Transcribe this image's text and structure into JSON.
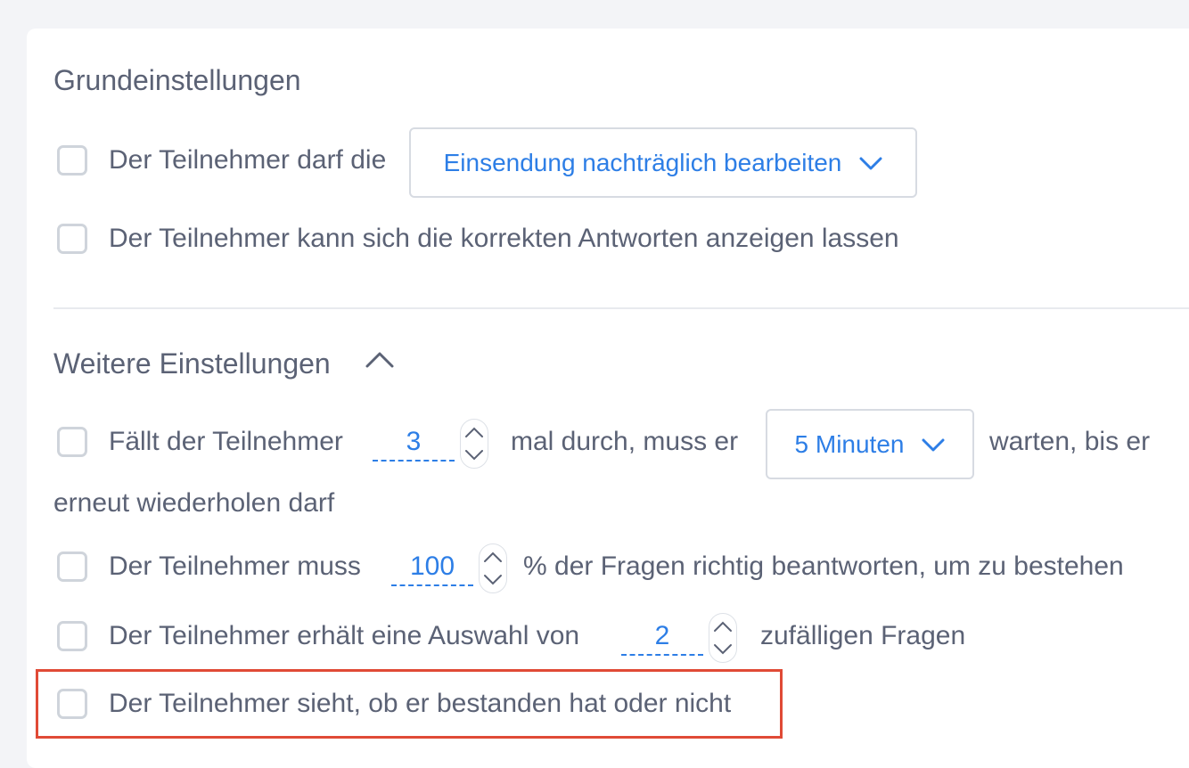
{
  "basic": {
    "title": "Grundeinstellungen",
    "edit_prefix": "Der Teilnehmer darf die",
    "edit_select_value": "Einsendung nachträglich bearbeiten",
    "show_answers_label": "Der Teilnehmer kann sich die korrekten Antworten anzeigen lassen"
  },
  "more": {
    "title": "Weitere Einstellungen",
    "fail_prefix": "Fällt der Teilnehmer",
    "fail_count": "3",
    "fail_middle": "mal durch, muss er",
    "wait_select_value": "5 Minuten",
    "fail_suffix": "warten, bis er",
    "fail_line2": "erneut wiederholen darf",
    "pass_prefix": "Der Teilnehmer muss",
    "pass_percent": "100",
    "pass_suffix": "% der Fragen richtig beantworten, um zu bestehen",
    "random_prefix": "Der Teilnehmer erhält eine Auswahl von",
    "random_count": "2",
    "random_suffix": "zufälligen Fragen",
    "result_label": "Der Teilnehmer sieht, ob er bestanden hat oder nicht"
  },
  "colors": {
    "accent": "#2d7ee6",
    "text": "#5b6275",
    "highlight": "#e04a36"
  }
}
